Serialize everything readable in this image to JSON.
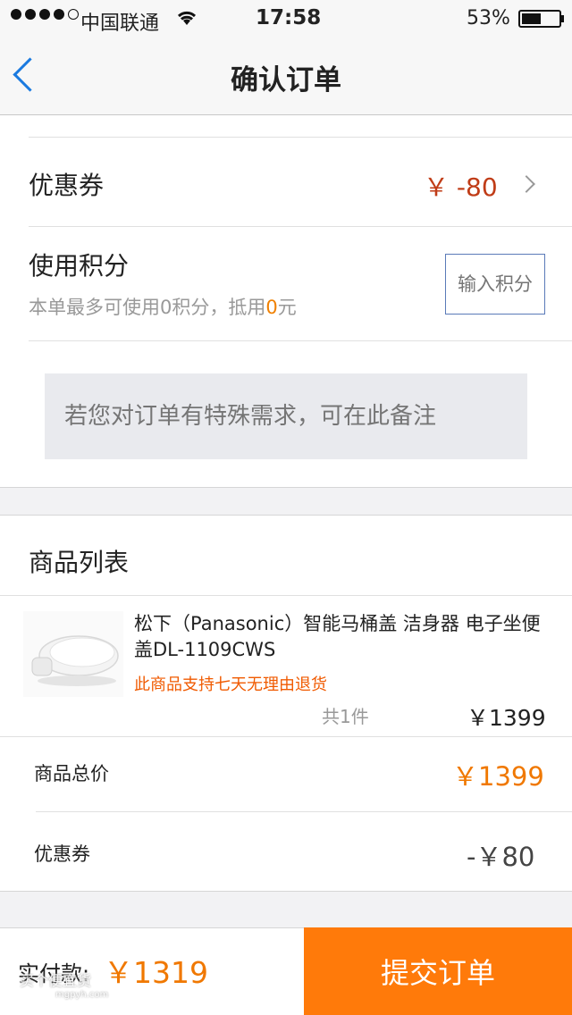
{
  "status_bar": {
    "carrier": "中国联通",
    "time": "17:58",
    "battery": "53%",
    "battery_level": 0.53,
    "signal_bars": 4
  },
  "nav": {
    "title": "确认订单",
    "back_icon": "chevron-left-icon",
    "accent_color": "#1a7ae0"
  },
  "coupon": {
    "label": "优惠券",
    "value": "￥ -80",
    "value_color": "#c03c17"
  },
  "points": {
    "label": "使用积分",
    "desc_prefix": "本单最多可使用0积分，抵用",
    "desc_amount": "0",
    "desc_suffix": "元",
    "input_placeholder": "输入积分"
  },
  "remark": {
    "placeholder": "若您对订单有特殊需求，可在此备注"
  },
  "product_list": {
    "title": "商品列表",
    "items": [
      {
        "name": "松下（Panasonic）智能马桶盖 洁身器 电子坐便盖DL-1109CWS",
        "note": "此商品支持七天无理由退货",
        "quantity": "共1件",
        "price": "￥1399"
      }
    ]
  },
  "summary": {
    "total_label": "商品总价",
    "total_value": "￥1399",
    "discount_label": "优惠券",
    "discount_value": "-￥80"
  },
  "footer": {
    "pay_label": "实付款:",
    "pay_value": "￥1319",
    "submit_label": "提交订单",
    "submit_color": "#ff7a0a",
    "watermark": "买个便宜货",
    "watermark_url": "mgpyh.com"
  }
}
